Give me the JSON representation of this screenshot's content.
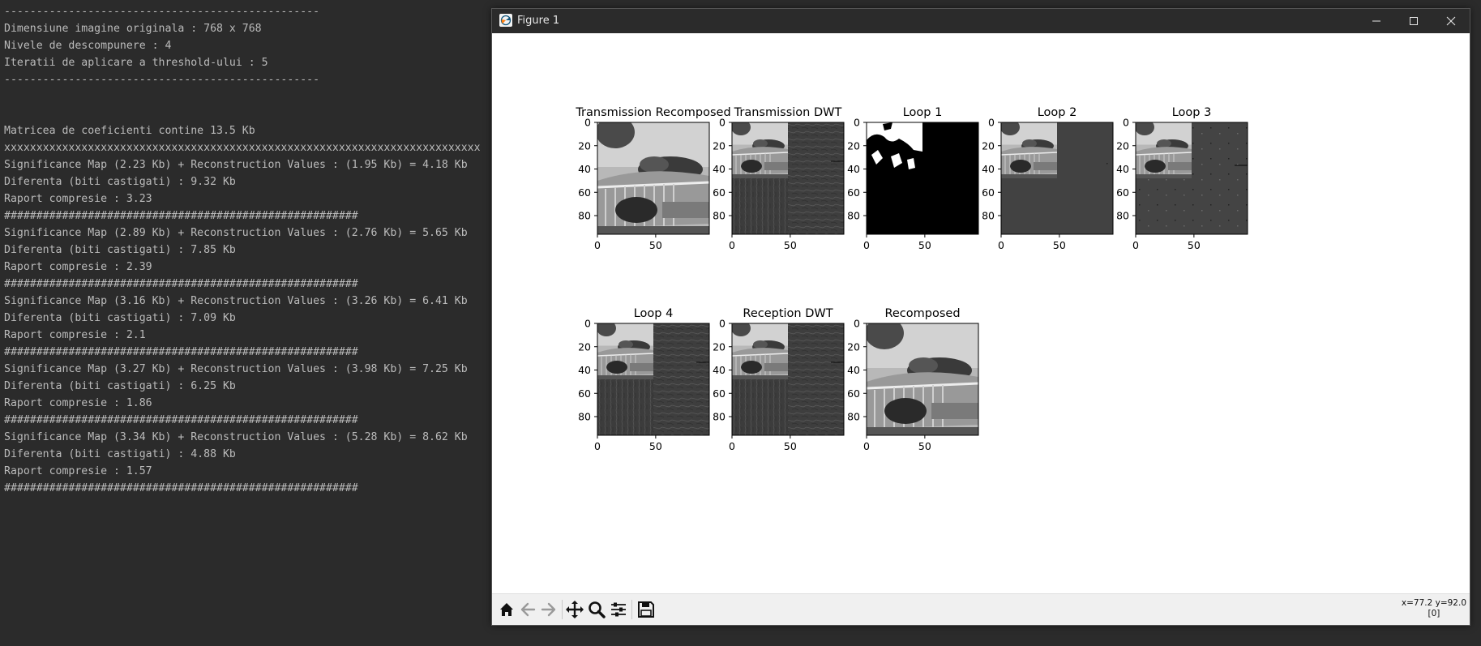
{
  "console": {
    "lines": [
      "-------------------------------------------------",
      "Dimensiune imagine originala : 768 x 768",
      "Nivele de descompunere : 4",
      "Iteratii de aplicare a threshold-ului : 5",
      "-------------------------------------------------",
      "",
      "",
      "Matricea de coeficienti contine 13.5 Kb",
      "xxxxxxxxxxxxxxxxxxxxxxxxxxxxxxxxxxxxxxxxxxxxxxxxxxxxxxxxxxxxxxxxxxxxxxxxxx",
      "Significance Map (2.23 Kb) + Reconstruction Values : (1.95 Kb) = 4.18 Kb",
      "Diferenta (biti castigati) : 9.32 Kb",
      "Raport compresie : 3.23",
      "#######################################################",
      "Significance Map (2.89 Kb) + Reconstruction Values : (2.76 Kb) = 5.65 Kb",
      "Diferenta (biti castigati) : 7.85 Kb",
      "Raport compresie : 2.39",
      "#######################################################",
      "Significance Map (3.16 Kb) + Reconstruction Values : (3.26 Kb) = 6.41 Kb",
      "Diferenta (biti castigati) : 7.09 Kb",
      "Raport compresie : 2.1",
      "#######################################################",
      "Significance Map (3.27 Kb) + Reconstruction Values : (3.98 Kb) = 7.25 Kb",
      "Diferenta (biti castigati) : 6.25 Kb",
      "Raport compresie : 1.86",
      "#######################################################",
      "Significance Map (3.34 Kb) + Reconstruction Values : (5.28 Kb) = 8.62 Kb",
      "Diferenta (biti castigati) : 4.88 Kb",
      "Raport compresie : 1.57",
      "#######################################################"
    ]
  },
  "window": {
    "title": "Figure 1",
    "icons": {
      "app": "matplotlib-icon",
      "minimize": "minimize-icon",
      "maximize": "maximize-icon",
      "close": "close-icon"
    }
  },
  "toolbar": {
    "buttons": [
      "home-icon",
      "back-arrow-icon",
      "forward-arrow-icon",
      "pan-icon",
      "zoom-icon",
      "configure-subplots-icon",
      "save-icon"
    ],
    "coords_line1": "x=77.2 y=92.0",
    "coords_line2": "[0]"
  },
  "chart_data": [
    {
      "type": "heatmap",
      "title": "Transmission Recomposed",
      "content": "recomposed-photo",
      "xticks": [
        0,
        50
      ],
      "yticks": [
        0,
        20,
        40,
        60,
        80
      ]
    },
    {
      "type": "heatmap",
      "title": "Transmission DWT",
      "content": "dwt-coefficients",
      "xticks": [
        0,
        50
      ],
      "yticks": [
        0,
        20,
        40,
        60,
        80
      ]
    },
    {
      "type": "heatmap",
      "title": "Loop 1",
      "content": "binary-threshold",
      "xticks": [
        0,
        50
      ],
      "yticks": [
        0,
        20,
        40,
        60,
        80
      ]
    },
    {
      "type": "heatmap",
      "title": "Loop 2",
      "content": "approximation-only",
      "xticks": [
        0,
        50
      ],
      "yticks": [
        0,
        20,
        40,
        60,
        80
      ]
    },
    {
      "type": "heatmap",
      "title": "Loop 3",
      "content": "approximation-sparse-details",
      "xticks": [
        0,
        50
      ],
      "yticks": [
        0,
        20,
        40,
        60,
        80
      ]
    },
    {
      "type": "heatmap",
      "title": "Loop 4",
      "content": "dwt-coefficients",
      "xticks": [
        0,
        50
      ],
      "yticks": [
        0,
        20,
        40,
        60,
        80
      ]
    },
    {
      "type": "heatmap",
      "title": "Reception DWT",
      "content": "dwt-coefficients",
      "xticks": [
        0,
        50
      ],
      "yticks": [
        0,
        20,
        40,
        60,
        80
      ]
    },
    {
      "type": "heatmap",
      "title": "Recomposed",
      "content": "recomposed-photo",
      "xticks": [
        0,
        50
      ],
      "yticks": [
        0,
        20,
        40,
        60,
        80
      ]
    }
  ],
  "colors": {
    "console_bg": "#2b2b2b",
    "console_text": "#bbbbbb",
    "titlebar_bg": "#2b2b2b",
    "toolbar_bg": "#f0f0f0"
  }
}
